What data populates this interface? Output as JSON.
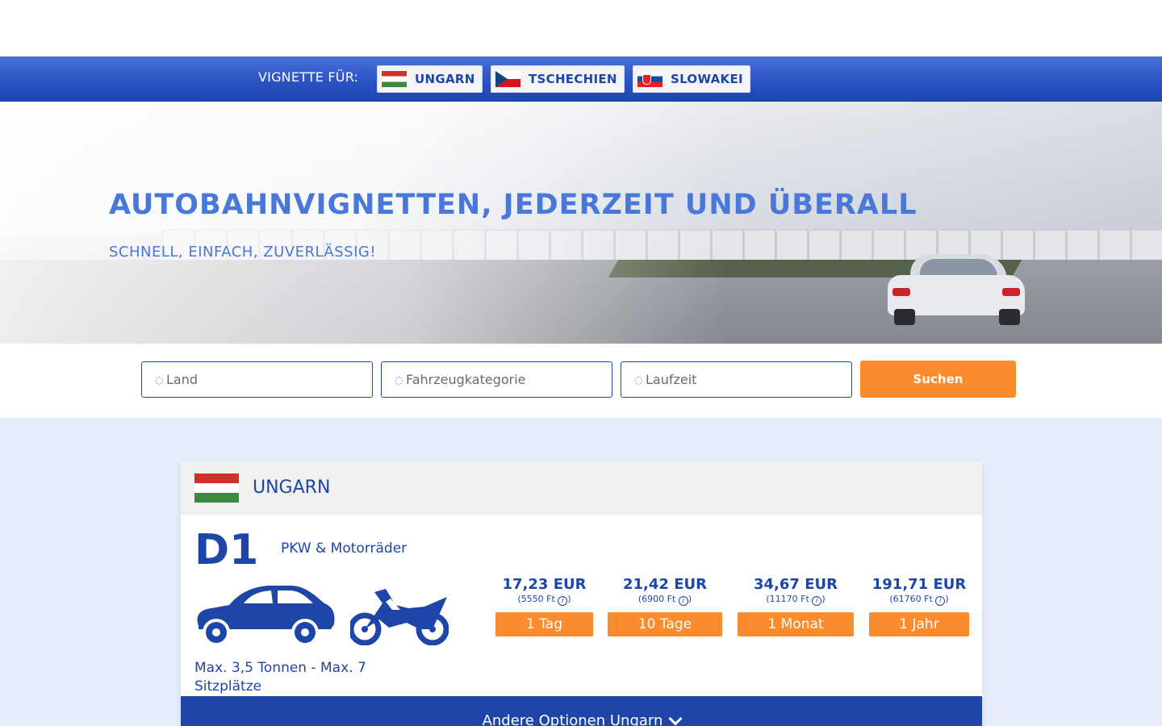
{
  "nav": {
    "label": "VIGNETTE FÜR:",
    "countries": [
      {
        "label": "UNGARN",
        "flag": "hungary-flag"
      },
      {
        "label": "TSCHECHIEN",
        "flag": "czech-flag"
      },
      {
        "label": "SLOWAKEI",
        "flag": "slovakia-flag"
      }
    ]
  },
  "hero": {
    "title": "AUTOBAHNVIGNETTEN, JEDERZEIT UND ÜBERALL",
    "subtitle": "SCHNELL, EINFACH, ZUVERLÄSSIG!"
  },
  "search": {
    "country_placeholder": "Land",
    "vehicle_placeholder": "Fahrzeugkategorie",
    "duration_placeholder": "Laufzeit",
    "submit_label": "Suchen"
  },
  "card": {
    "country": "UNGARN",
    "code": "D1",
    "category": "PKW & Motorräder",
    "limits": "Max. 3,5 Tonnen - Max. 7 Sitzplätze",
    "prices": [
      {
        "amount": "17,23 EUR",
        "huf": "(5550 Ft",
        "duration": "1 Tag"
      },
      {
        "amount": "21,42 EUR",
        "huf": "(6900 Ft",
        "duration": "10 Tage"
      },
      {
        "amount": "34,67 EUR",
        "huf": "(11170 Ft",
        "duration": "1 Monat"
      },
      {
        "amount": "191,71 EUR",
        "huf": "(61760 Ft",
        "duration": "1 Jahr"
      }
    ],
    "more_options": "Andere Optionen Ungarn"
  },
  "colors": {
    "primary": "#1e45a8",
    "accent_orange": "#fa8c2e",
    "hero_text": "#4a78d8",
    "page_bg": "#e6edfd"
  },
  "icons": {
    "car": "car-icon",
    "motorcycle": "motorcycle-icon",
    "info": "info-icon",
    "chevron": "chevron-down-icon"
  }
}
